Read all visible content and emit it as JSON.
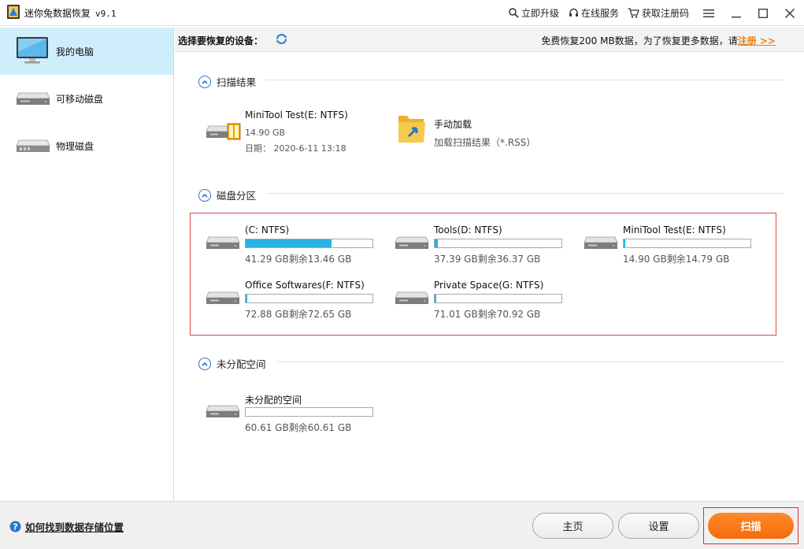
{
  "titlebar": {
    "app_title": "迷你兔数据恢复",
    "version": "v9.1",
    "upgrade": "立即升级",
    "online_service": "在线服务",
    "get_code": "获取注册码"
  },
  "sidebar": {
    "items": [
      {
        "label": "我的电脑",
        "icon": "monitor-icon",
        "active": true
      },
      {
        "label": "可移动磁盘",
        "icon": "removable-disk-icon",
        "active": false
      },
      {
        "label": "物理磁盘",
        "icon": "physical-disk-icon",
        "active": false
      }
    ]
  },
  "devbar": {
    "title": "选择要恢复的设备：",
    "promo_text": "免费恢复200 MB数据，为了恢复更多数据，请",
    "register_link": "注册 >>"
  },
  "sections": {
    "scan_results": {
      "title": "扫描结果",
      "items": [
        {
          "name": "MiniTool Test(E: NTFS)",
          "size": "14.90 GB",
          "date": "日期： 2020-6-11 13:18"
        },
        {
          "name": "手动加载",
          "sub": "加载扫描结果（*.RSS）"
        }
      ]
    },
    "partitions": {
      "title": "磁盘分区",
      "drives": [
        {
          "name": "(C: NTFS)",
          "size": "41.29 GB剩余13.46 GB",
          "used_fraction": 0.674
        },
        {
          "name": "Tools(D: NTFS)",
          "size": "37.39 GB剩余36.37 GB",
          "used_fraction": 0.027
        },
        {
          "name": "MiniTool Test(E: NTFS)",
          "size": "14.90 GB剩余14.79 GB",
          "used_fraction": 0.007
        },
        {
          "name": "Office Softwares(F: NTFS)",
          "size": "72.88 GB剩余72.65 GB",
          "used_fraction": 0.003
        },
        {
          "name": "Private Space(G: NTFS)",
          "size": "71.01 GB剩余70.92 GB",
          "used_fraction": 0.001
        }
      ]
    },
    "unallocated": {
      "title": "未分配空间",
      "drives": [
        {
          "name": "未分配的空间",
          "size": "60.61 GB剩余60.61 GB",
          "used_fraction": 0
        }
      ]
    }
  },
  "bottombar": {
    "help": "如何找到数据存储位置",
    "home": "主页",
    "settings": "设置",
    "scan": "扫描"
  },
  "colors": {
    "accent_orange": "#f36b0c",
    "sidebar_active": "#cfeefc",
    "bar_fill": "#2ab1e4",
    "collapse_blue": "#2b74c8",
    "highlight_red": "#d94a4a"
  }
}
